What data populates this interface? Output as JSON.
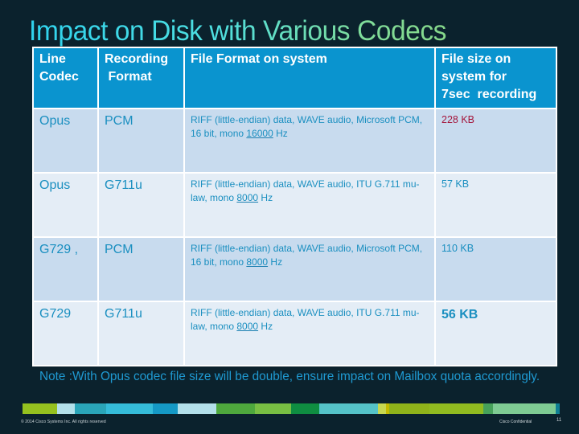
{
  "slide": {
    "title": "Impact on Disk with Various Codecs",
    "note": "Note :With Opus codec file size will be double, ensure impact on Mailbox quota accordingly.",
    "footer_copyright": "© 2014 Cisco Systems Inc. All rights reserved",
    "footer_confidential": "Cisco Confidential",
    "page_number": "11"
  },
  "table": {
    "headers": [
      "Line Codec",
      "Recording  Format",
      "File Format on system",
      "File size on system for 7sec  recording"
    ],
    "header_lines": {
      "col0": [
        "Line",
        "Codec"
      ],
      "col1": [
        "Recording",
        " Format"
      ],
      "col2": [
        "File Format on system"
      ],
      "col3": [
        "File size on",
        "system for",
        "7sec  recording"
      ]
    },
    "rows": [
      {
        "line_codec": "Opus",
        "recording_format": "PCM",
        "file_format_pre": "RIFF (little-endian) data, WAVE audio, Microsoft PCM, 16 bit, mono ",
        "file_format_rate": "16000",
        "file_format_post": " Hz",
        "file_size": "228 KB"
      },
      {
        "line_codec": "Opus",
        "recording_format": "G711u",
        "file_format_pre": "RIFF (little-endian) data, WAVE audio, ITU G.711 mu-law, mono ",
        "file_format_rate": "8000",
        "file_format_post": " Hz",
        "file_size": "57 KB"
      },
      {
        "line_codec": "G729 ,",
        "recording_format": "PCM",
        "file_format_pre": "RIFF (little-endian) data, WAVE audio, Microsoft PCM, 16 bit, mono ",
        "file_format_rate": "8000",
        "file_format_post": " Hz",
        "file_size": "110 KB"
      },
      {
        "line_codec": "G729",
        "recording_format": "G711u",
        "file_format_pre": "RIFF (little-endian) data, WAVE audio, ITU G.711 mu-law, mono ",
        "file_format_rate": "8000",
        "file_format_post": " Hz",
        "file_size": "56 KB"
      }
    ]
  },
  "colors": {
    "background": "#0b222d",
    "header_fill": "#0a94cf",
    "row_dark": "#c8dbee",
    "row_light": "#e4edf6",
    "text_blue": "#1a8fc0",
    "highlight_red": "#a4163c",
    "note_text": "#1f9ad2",
    "stripe_palette": [
      "#95c11f",
      "#b3e0ea",
      "#2aa5b8",
      "#35bcd9",
      "#1599c5",
      "#b3e0ea",
      "#4ea83d",
      "#78bf43",
      "#0f8d41",
      "#55c3c8",
      "#c8d850",
      "#c4bb00",
      "#8fb31a",
      "#91bb20",
      "#46a15a",
      "#7ecb93",
      "#0f7f93"
    ]
  }
}
